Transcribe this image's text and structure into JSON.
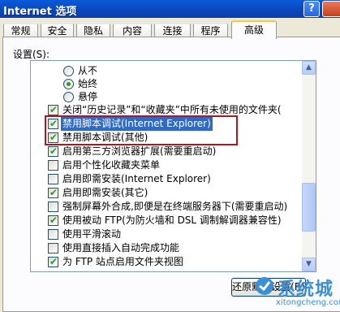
{
  "window": {
    "title": "Internet 选项",
    "help_label": "?"
  },
  "tabs": [
    {
      "label": "常规",
      "active": false
    },
    {
      "label": "安全",
      "active": false
    },
    {
      "label": "隐私",
      "active": false
    },
    {
      "label": "内容",
      "active": false
    },
    {
      "label": "连接",
      "active": false
    },
    {
      "label": "程序",
      "active": false
    },
    {
      "label": "高级",
      "active": true
    }
  ],
  "settings_label": "设置(S):",
  "settings": [
    {
      "type": "radio",
      "label": "从不",
      "checked": false
    },
    {
      "type": "radio",
      "label": "始终",
      "checked": true
    },
    {
      "type": "radio",
      "label": "悬停",
      "checked": false
    },
    {
      "type": "checkbox",
      "label": "关闭“历史记录”和“收藏夹”中所有未使用的文件夹(",
      "checked": true
    },
    {
      "type": "checkbox",
      "label": "禁用脚本调试(Internet Explorer)",
      "checked": true,
      "selected": true
    },
    {
      "type": "checkbox",
      "label": "禁用脚本调试(其他)",
      "checked": true
    },
    {
      "type": "checkbox",
      "label": "启用第三方浏览器扩展(需要重启动)",
      "checked": true
    },
    {
      "type": "checkbox",
      "label": "启用个性化收藏夹菜单",
      "checked": false
    },
    {
      "type": "checkbox",
      "label": "启用即需安装(Internet Explorer)",
      "checked": false
    },
    {
      "type": "checkbox",
      "label": "启用即需安装(其它)",
      "checked": true
    },
    {
      "type": "checkbox",
      "label": "强制屏幕外合成,即便是在终端服务器下(需要重启动)",
      "checked": false
    },
    {
      "type": "checkbox",
      "label": "使用被动 FTP(为防火墙和 DSL 调制解调器兼容性)",
      "checked": true
    },
    {
      "type": "checkbox",
      "label": "使用平滑滚动",
      "checked": false
    },
    {
      "type": "checkbox",
      "label": "使用直接插入自动完成功能",
      "checked": false
    },
    {
      "type": "checkbox",
      "label": "为 FTP 站点启用文件夹视图",
      "checked": true
    }
  ],
  "scrollbar": {
    "up_glyph": "▲",
    "down_glyph": "▼"
  },
  "buttons": {
    "restore_defaults": "还原默认设置(R)"
  },
  "watermark": {
    "main": "系统城",
    "url": "xitongcheng.com"
  }
}
